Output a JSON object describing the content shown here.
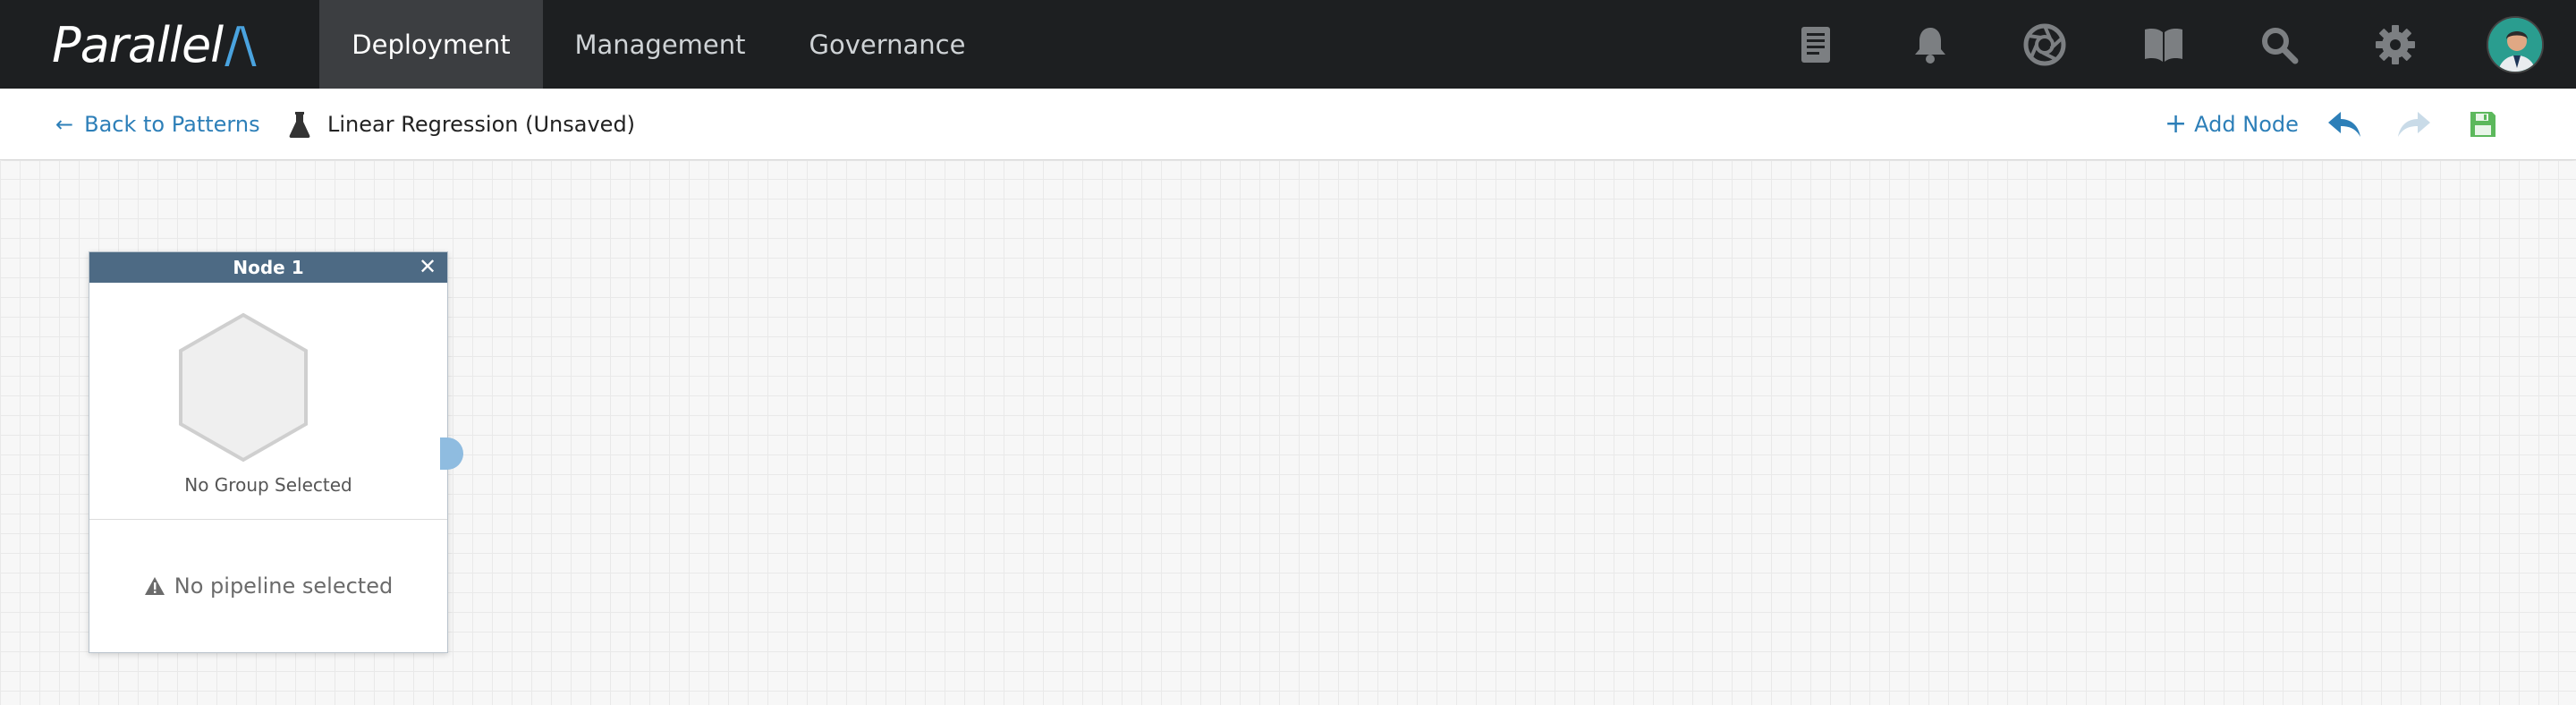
{
  "app": {
    "logo_text": "Parallel",
    "logo_accent": "/\\"
  },
  "topnav": {
    "tabs": [
      {
        "label": "Deployment",
        "active": true
      },
      {
        "label": "Management",
        "active": false
      },
      {
        "label": "Governance",
        "active": false
      }
    ],
    "icons": [
      "document-icon",
      "bell-icon",
      "aperture-icon",
      "book-icon",
      "search-icon",
      "gear-icon",
      "avatar"
    ]
  },
  "toolbar": {
    "back_label": "Back to Patterns",
    "pattern_title": "Linear Regression (Unsaved)",
    "add_node_label": "Add Node",
    "undo_enabled": true,
    "redo_enabled": false
  },
  "node": {
    "title": "Node 1",
    "group_label": "No Group Selected",
    "pipeline_label": "No pipeline selected"
  },
  "colors": {
    "accent": "#2d7fb8",
    "save": "#5cb85c",
    "node_header": "#4d6a84",
    "topnav_bg": "#1d1f21"
  }
}
